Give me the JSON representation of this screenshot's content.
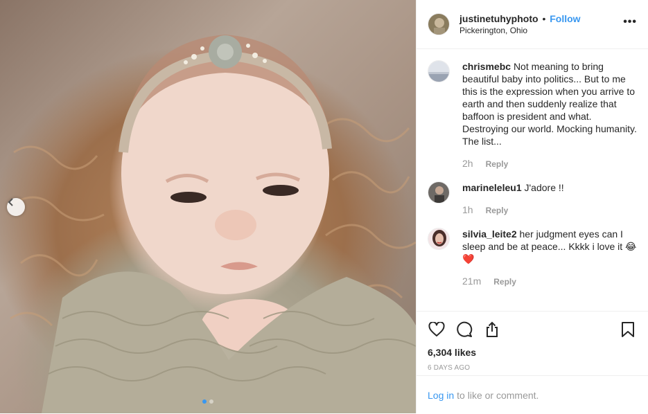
{
  "post": {
    "username": "justinetuhyphoto",
    "separator": "•",
    "follow_label": "Follow",
    "location": "Pickerington, Ohio",
    "more_glyph": "•••"
  },
  "comments": [
    {
      "user": "chrismebc",
      "text": "Not meaning to bring beautiful baby into politics... But to me this is the expression when you arrive to earth and then suddenly realize that baffoon is president and what. Destroying our world. Mocking humanity. The list...",
      "time": "2h",
      "reply_label": "Reply",
      "avatar_icon": "landscape-avatar"
    },
    {
      "user": "marineleleu1",
      "text": "J'adore !!",
      "time": "1h",
      "reply_label": "Reply",
      "avatar_icon": "person-avatar"
    },
    {
      "user": "silvia_leite2",
      "text": "her judgment eyes can I sleep and be at peace... Kkkk i love it 😂❤️",
      "time": "21m",
      "reply_label": "Reply",
      "avatar_icon": "woman-avatar"
    }
  ],
  "actions": {
    "like_icon": "heart-icon",
    "comment_icon": "comment-bubble-icon",
    "share_icon": "share-icon",
    "save_icon": "bookmark-icon"
  },
  "likes_text": "6,304 likes",
  "posted_ago": "6 DAYS AGO",
  "login": {
    "link_label": "Log in",
    "rest_text": "to like or comment."
  },
  "carousel": {
    "prev_icon": "chevron-left-icon",
    "total_slides": 2,
    "active_slide": 1
  },
  "colors": {
    "link_blue": "#3897f0",
    "text": "#262626",
    "muted": "#999999",
    "divider": "#efefef"
  }
}
